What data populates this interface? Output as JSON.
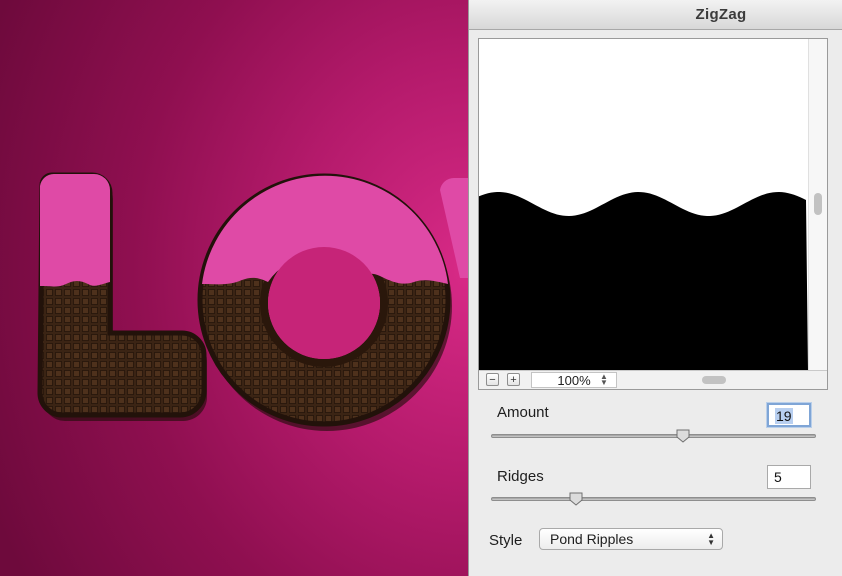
{
  "window": {
    "title": "ZigZag"
  },
  "preview": {
    "zoom_out_label": "−",
    "zoom_in_label": "+",
    "zoom_value": "100%",
    "zoom_stepper_icon": "updown-arrows-icon"
  },
  "controls": {
    "amount": {
      "label": "Amount",
      "value": "19",
      "slider_fraction": 0.59
    },
    "ridges": {
      "label": "Ridges",
      "value": "5",
      "slider_fraction": 0.26
    }
  },
  "style": {
    "label": "Style",
    "selected": "Pond Ripples"
  },
  "colors": {
    "background_magenta": "#b41a6b",
    "icing_pink": "#df4aa6",
    "chocolate": "#3a2414",
    "dialog_bg": "#ececec",
    "selection_blue": "#b8cff0"
  }
}
